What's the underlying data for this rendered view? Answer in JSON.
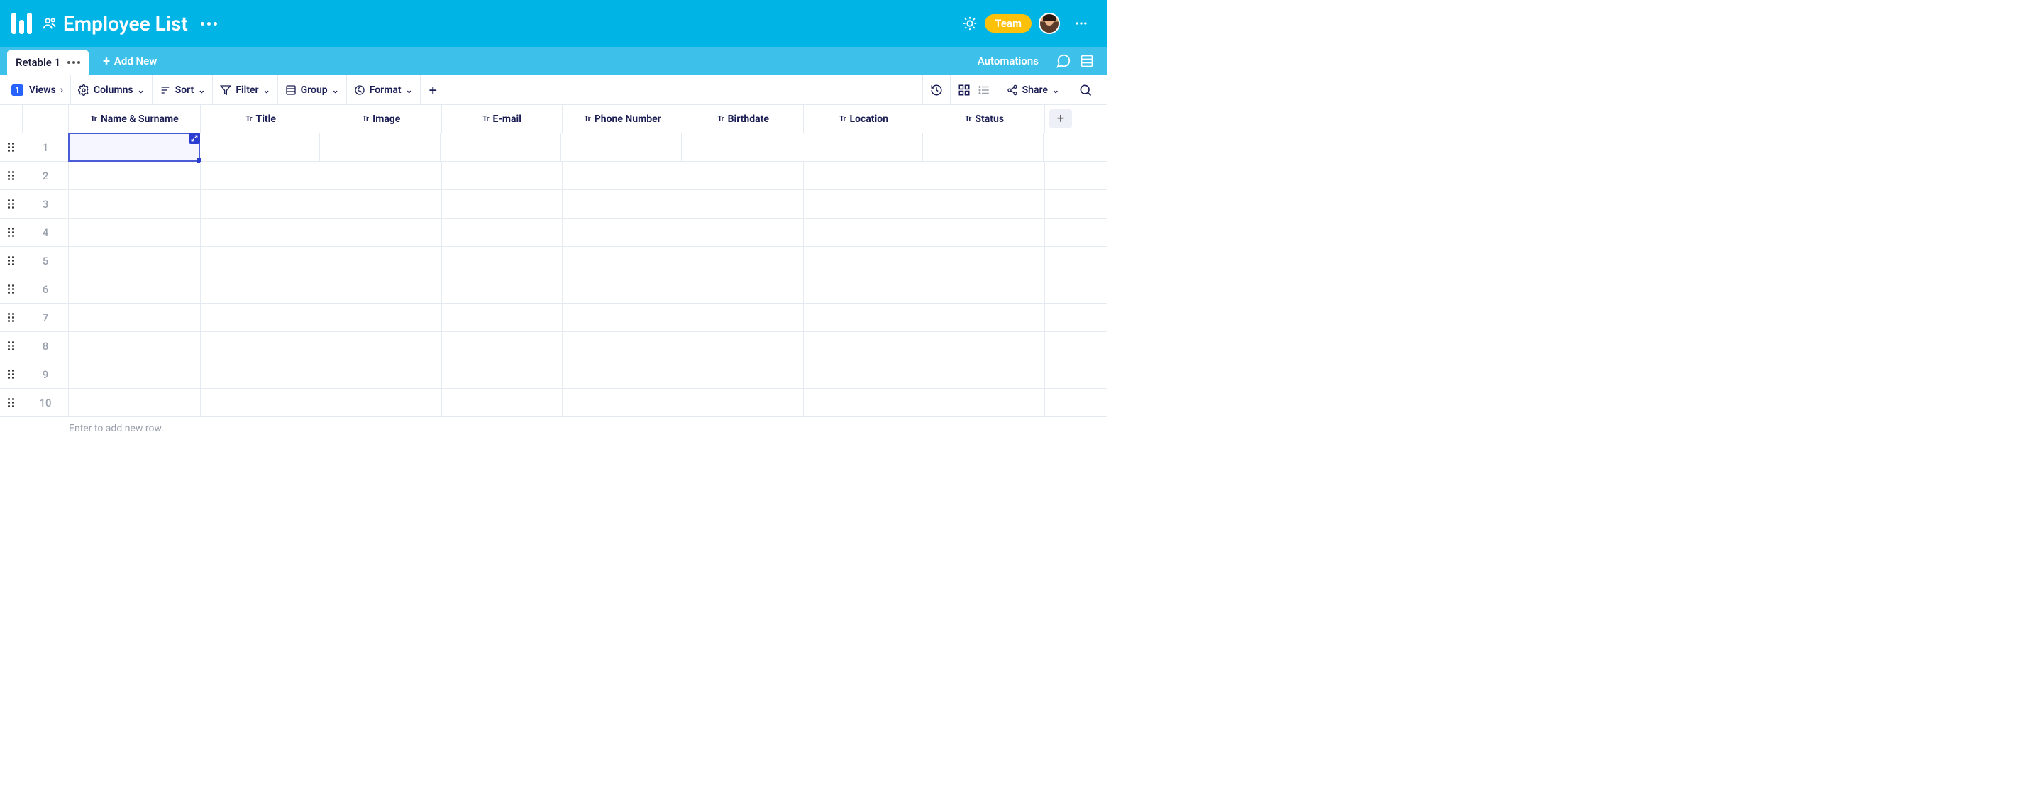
{
  "header": {
    "title": "Employee List",
    "team_badge": "Team"
  },
  "tabs": {
    "active_tab": "Retable 1",
    "add_new_label": "Add New",
    "automations_label": "Automations"
  },
  "toolbar": {
    "views_count": "1",
    "views_label": "Views",
    "columns_label": "Columns",
    "sort_label": "Sort",
    "filter_label": "Filter",
    "group_label": "Group",
    "format_label": "Format",
    "share_label": "Share"
  },
  "columns": [
    {
      "label": "Name & Surname",
      "type": "text"
    },
    {
      "label": "Title",
      "type": "text"
    },
    {
      "label": "Image",
      "type": "text"
    },
    {
      "label": "E-mail",
      "type": "text"
    },
    {
      "label": "Phone Number",
      "type": "text"
    },
    {
      "label": "Birthdate",
      "type": "text"
    },
    {
      "label": "Location",
      "type": "text"
    },
    {
      "label": "Status",
      "type": "text"
    }
  ],
  "rows": [
    {
      "num": "1"
    },
    {
      "num": "2"
    },
    {
      "num": "3"
    },
    {
      "num": "4"
    },
    {
      "num": "5"
    },
    {
      "num": "6"
    },
    {
      "num": "7"
    },
    {
      "num": "8"
    },
    {
      "num": "9"
    },
    {
      "num": "10"
    }
  ],
  "footer": {
    "add_row_hint": "Enter to add new row."
  }
}
